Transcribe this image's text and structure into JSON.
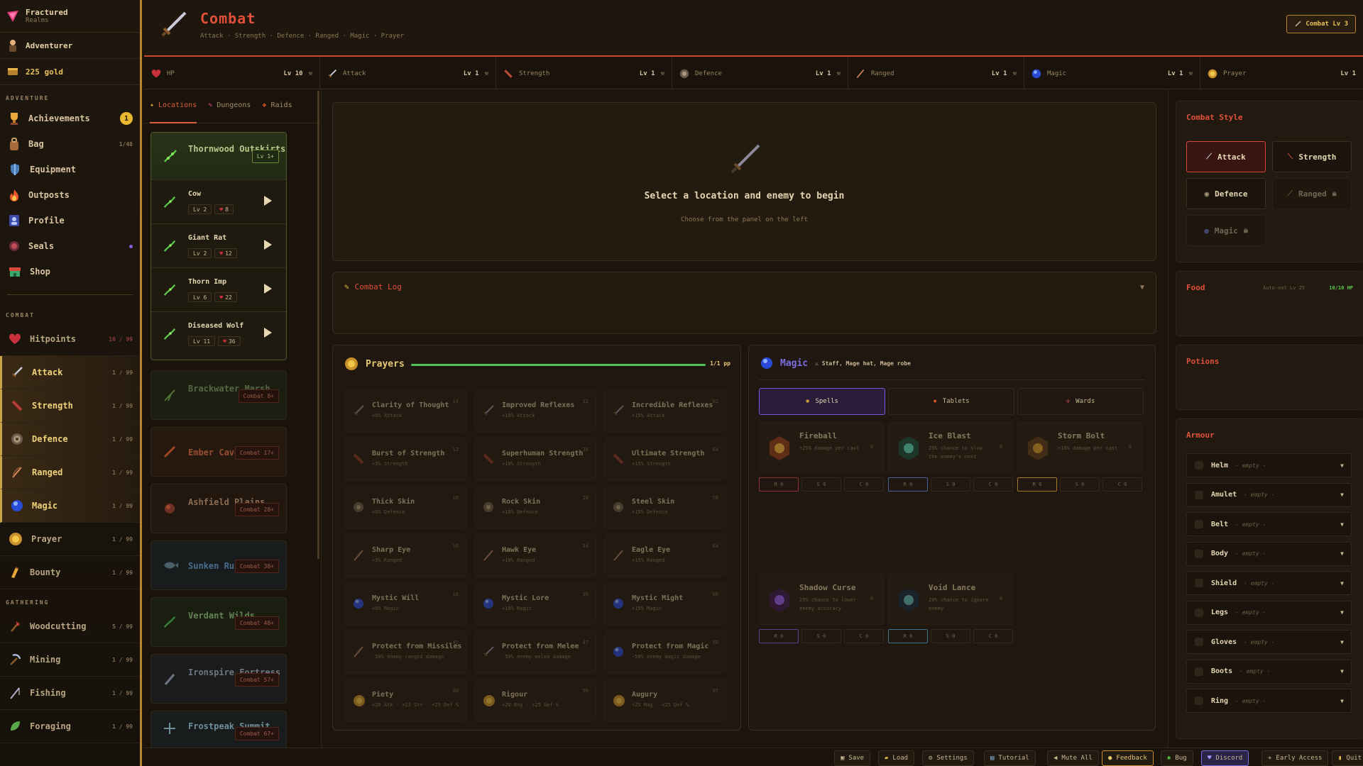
{
  "brand": {
    "name": "Fractured",
    "sub": "Realms"
  },
  "player": {
    "name": "Adventurer",
    "gold": "225 gold"
  },
  "sidebar": {
    "adventure_head": "ADVENTURE",
    "adventure": [
      {
        "label": "Achievements",
        "badge": "1"
      },
      {
        "label": "Bag",
        "count": "1/48"
      },
      {
        "label": "Equipment"
      },
      {
        "label": "Outposts"
      },
      {
        "label": "Profile"
      },
      {
        "label": "Seals"
      },
      {
        "label": "Shop"
      }
    ],
    "combat_head": "COMBAT",
    "combat": [
      {
        "label": "Hitpoints",
        "count": "10 / 99"
      },
      {
        "label": "Attack",
        "count": "1 / 99"
      },
      {
        "label": "Strength",
        "count": "1 / 99"
      },
      {
        "label": "Defence",
        "count": "1 / 99"
      },
      {
        "label": "Ranged",
        "count": "1 / 99"
      },
      {
        "label": "Magic",
        "count": "1 / 99"
      },
      {
        "label": "Prayer",
        "count": "1 / 99"
      },
      {
        "label": "Bounty",
        "count": "1 / 99"
      }
    ],
    "gathering_head": "GATHERING",
    "gathering": [
      {
        "label": "Woodcutting",
        "count": "5 / 99"
      },
      {
        "label": "Mining",
        "count": "1 / 99"
      },
      {
        "label": "Fishing",
        "count": "1 / 99"
      },
      {
        "label": "Foraging",
        "count": "1 / 99"
      }
    ]
  },
  "header": {
    "title": "Combat",
    "subtitle": "Attack · Strength · Defence · Ranged · Magic · Prayer",
    "level": "Combat Lv 3"
  },
  "stats": [
    {
      "name": "HP",
      "lv": "Lv 10"
    },
    {
      "name": "Attack",
      "lv": "Lv 1"
    },
    {
      "name": "Strength",
      "lv": "Lv 1"
    },
    {
      "name": "Defence",
      "lv": "Lv 1"
    },
    {
      "name": "Ranged",
      "lv": "Lv 1"
    },
    {
      "name": "Magic",
      "lv": "Lv 1"
    },
    {
      "name": "Prayer",
      "lv": "Lv 1"
    }
  ],
  "loc_tabs": [
    "Locations",
    "Dungeons",
    "Raids"
  ],
  "locations": [
    {
      "name": "Thornwood Outskirts",
      "req": "Lv 1+",
      "color": "#b8c88a"
    },
    {
      "name": "Brackwater Marsh",
      "req": "Combat 8+",
      "color": "#6f8a5a"
    },
    {
      "name": "Ember Caves",
      "req": "Combat 17+",
      "color": "#c0603a"
    },
    {
      "name": "Ashfield Plains",
      "req": "Combat 28+",
      "color": "#b08a6a"
    },
    {
      "name": "Sunken Ruins",
      "req": "Combat 38+",
      "color": "#5a8ab8"
    },
    {
      "name": "Verdant Wilds",
      "req": "Combat 48+",
      "color": "#7aa86a"
    },
    {
      "name": "Ironspire Fortress",
      "req": "Combat 57+",
      "color": "#8a98a8"
    },
    {
      "name": "Frostpeak Summit",
      "req": "Combat 67+",
      "color": "#8ab8c8"
    }
  ],
  "enemies": [
    {
      "name": "Cow",
      "lv": "Lv 2",
      "hp": "8"
    },
    {
      "name": "Giant Rat",
      "lv": "Lv 2",
      "hp": "12"
    },
    {
      "name": "Thorn Imp",
      "lv": "Lv 6",
      "hp": "22"
    },
    {
      "name": "Diseased Wolf",
      "lv": "Lv 11",
      "hp": "36"
    }
  ],
  "stage": {
    "title": "Select a location and enemy to begin",
    "sub": "Choose from the panel on the left"
  },
  "log": {
    "title": "Combat Log"
  },
  "prayers": {
    "title": "Prayers",
    "pp": "1/1 pp",
    "items": [
      {
        "name": "Clarity of Thought",
        "desc": "+5% Attack",
        "lv": "14",
        "icon": "sword"
      },
      {
        "name": "Improved Reflexes",
        "desc": "+10% Attack",
        "lv": "32",
        "icon": "sword"
      },
      {
        "name": "Incredible Reflexes",
        "desc": "+15% Attack",
        "lv": "62",
        "icon": "sword"
      },
      {
        "name": "Burst of Strength",
        "desc": "+5% Strength",
        "lv": "12",
        "icon": "fist"
      },
      {
        "name": "Superhuman Strength",
        "desc": "+10% Strength",
        "lv": "38",
        "icon": "fist"
      },
      {
        "name": "Ultimate Strength",
        "desc": "+15% Strength",
        "lv": "64",
        "icon": "fist"
      },
      {
        "name": "Thick Skin",
        "desc": "+5% Defence",
        "lv": "10",
        "icon": "shield"
      },
      {
        "name": "Rock Skin",
        "desc": "+10% Defence",
        "lv": "28",
        "icon": "shield"
      },
      {
        "name": "Steel Skin",
        "desc": "+15% Defence",
        "lv": "58",
        "icon": "shield"
      },
      {
        "name": "Sharp Eye",
        "desc": "+5% Ranged",
        "lv": "16",
        "icon": "bow"
      },
      {
        "name": "Hawk Eye",
        "desc": "+10% Ranged",
        "lv": "34",
        "icon": "bow"
      },
      {
        "name": "Eagle Eye",
        "desc": "+15% Ranged",
        "lv": "64",
        "icon": "bow"
      },
      {
        "name": "Mystic Will",
        "desc": "+5% Magic",
        "lv": "18",
        "icon": "orb"
      },
      {
        "name": "Mystic Lore",
        "desc": "+10% Magic",
        "lv": "36",
        "icon": "orb"
      },
      {
        "name": "Mystic Might",
        "desc": "+15% Magic",
        "lv": "66",
        "icon": "orb"
      },
      {
        "name": "Protect from Missiles",
        "desc": "-50% enemy ranged damage",
        "lv": "45",
        "icon": "bow"
      },
      {
        "name": "Protect from Melee",
        "desc": "-50% enemy melee damage",
        "lv": "47",
        "icon": "sword"
      },
      {
        "name": "Protect from Magic",
        "desc": "-50% enemy magic damage",
        "lv": "58",
        "icon": "orb"
      },
      {
        "name": "Piety",
        "desc": "+20 Atk · +23 Str · +25 Def %",
        "lv": "80",
        "icon": "sun"
      },
      {
        "name": "Rigour",
        "desc": "+20 Rng · +25 Def %",
        "lv": "90",
        "icon": "sun"
      },
      {
        "name": "Augury",
        "desc": "+25 Mag · +25 Def %",
        "lv": "97",
        "icon": "sun"
      }
    ]
  },
  "magic": {
    "title": "Magic",
    "note": "⚠ Staff, Mage hat, Mage robe",
    "tabs": [
      "Spells",
      "Tablets",
      "Wards"
    ],
    "spells": [
      {
        "name": "Fireball",
        "desc": "+25% damage per cast",
        "count": "0"
      },
      {
        "name": "Ice Blast",
        "desc": "25% chance to slow the enemy's next",
        "count": "0"
      },
      {
        "name": "Storm Bolt",
        "desc": "+10% damage per cast",
        "count": "0"
      },
      {
        "name": "Shadow Curse",
        "desc": "25% chance to lower enemy accuracy",
        "count": "0"
      },
      {
        "name": "Void Lance",
        "desc": "20% chance to ignore enemy",
        "count": "0"
      }
    ],
    "runes": [
      "R 0",
      "S 0",
      "C 0"
    ]
  },
  "right": {
    "style_title": "Combat Style",
    "styles": [
      "Attack",
      "Strength",
      "Defence",
      "Ranged",
      "Magic"
    ],
    "food_title": "Food",
    "auto_eat": "Auto-eat Lv 25",
    "hp": "10/10 HP",
    "potions_title": "Potions",
    "armour_title": "Armour",
    "armour": [
      "Helm",
      "Amulet",
      "Belt",
      "Body",
      "Shield",
      "Legs",
      "Gloves",
      "Boots",
      "Ring"
    ],
    "empty": "- empty -"
  },
  "footer": [
    "Save",
    "Load",
    "Settings",
    "Tutorial",
    "Mute All",
    "Feedback",
    "Bug",
    "Discord",
    "Early Access",
    "Quit"
  ]
}
